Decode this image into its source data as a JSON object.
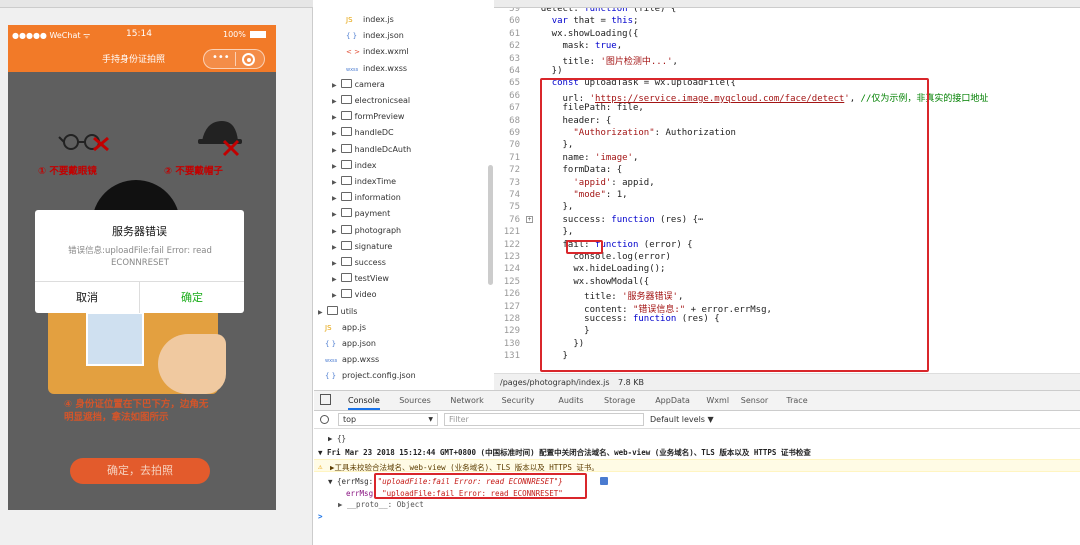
{
  "simulator": {
    "status_left": "●●●●● WeChat ᯤ",
    "status_time": "15:14",
    "status_battery": "100%",
    "nav_title": "手持身份证拍照",
    "capsule_dots": "•••",
    "tip1": "① 不要戴眼镜",
    "tip2": "② 不要戴帽子",
    "tip4": "④ 身份证位置在下巴下方，边角无明显遮挡，拿法如图所示",
    "confirm_btn": "确定，去拍照",
    "modal_title": "服务器错误",
    "modal_content": "错误信息:uploadFile:fail Error: read ECONNRESET",
    "modal_cancel": "取消",
    "modal_ok": "确定"
  },
  "tree": [
    {
      "label": "index.js",
      "icon": "JS",
      "color": "#e5a000",
      "indent": 4
    },
    {
      "label": "index.json",
      "icon": "{ }",
      "color": "#4a7bd0",
      "indent": 4
    },
    {
      "label": "index.wxml",
      "icon": "< >",
      "color": "#e0482e",
      "indent": 4
    },
    {
      "label": "index.wxss",
      "icon": "wxss",
      "color": "#4a7bd0",
      "indent": 4
    },
    {
      "label": "camera",
      "icon": "folder",
      "indent": 2
    },
    {
      "label": "electronicseal",
      "icon": "folder",
      "indent": 2
    },
    {
      "label": "formPreview",
      "icon": "folder",
      "indent": 2
    },
    {
      "label": "handleDC",
      "icon": "folder",
      "indent": 2
    },
    {
      "label": "handleDcAuth",
      "icon": "folder",
      "indent": 2
    },
    {
      "label": "index",
      "icon": "folder",
      "indent": 2
    },
    {
      "label": "indexTime",
      "icon": "folder",
      "indent": 2
    },
    {
      "label": "information",
      "icon": "folder",
      "indent": 2
    },
    {
      "label": "payment",
      "icon": "folder",
      "indent": 2
    },
    {
      "label": "photograph",
      "icon": "folder",
      "indent": 2
    },
    {
      "label": "signature",
      "icon": "folder",
      "indent": 2
    },
    {
      "label": "success",
      "icon": "folder",
      "indent": 2
    },
    {
      "label": "testView",
      "icon": "folder",
      "indent": 2
    },
    {
      "label": "video",
      "icon": "folder",
      "indent": 2
    },
    {
      "label": "utils",
      "icon": "folder",
      "indent": 0
    },
    {
      "label": "app.js",
      "icon": "JS",
      "color": "#e5a000",
      "indent": 1
    },
    {
      "label": "app.json",
      "icon": "{ }",
      "color": "#4a7bd0",
      "indent": 1
    },
    {
      "label": "app.wxss",
      "icon": "wxss",
      "color": "#4a7bd0",
      "indent": 1
    },
    {
      "label": "project.config.json",
      "icon": "{ }",
      "color": "#4a7bd0",
      "indent": 1
    }
  ],
  "editor": {
    "lines": [
      {
        "n": "59",
        "html": "  detect: <span class=\"kw\">function</span> (file) {"
      },
      {
        "n": "60",
        "html": "    <span class=\"kw\">var</span> that = <span class=\"kw\">this</span>;"
      },
      {
        "n": "61",
        "html": "    wx.showLoading({"
      },
      {
        "n": "62",
        "html": "      mask: <span class=\"kw\">true</span>,"
      },
      {
        "n": "63",
        "html": "      title: <span class=\"str\">'图片检测中...'</span>,"
      },
      {
        "n": "64",
        "html": "    })"
      },
      {
        "n": "65",
        "html": "    <span class=\"kw\">const</span> uploadTask = wx.uploadFile({"
      },
      {
        "n": "66",
        "html": "      url: <span class=\"str\">'</span><span class=\"url\">https://service.image.myqcloud.com/face/detect</span><span class=\"str\">'</span>, <span class=\"cm\">//仅为示例，非真实的接口地址</span>"
      },
      {
        "n": "67",
        "html": "      filePath: file,"
      },
      {
        "n": "68",
        "html": "      header: {"
      },
      {
        "n": "69",
        "html": "        <span class=\"str\">\"Authorization\"</span>: Authorization"
      },
      {
        "n": "70",
        "html": "      },"
      },
      {
        "n": "71",
        "html": "      name: <span class=\"str\">'image'</span>,"
      },
      {
        "n": "72",
        "html": "      formData: {"
      },
      {
        "n": "73",
        "html": "        <span class=\"str\">'appid'</span>: appid,"
      },
      {
        "n": "74",
        "html": "        <span class=\"str\">\"mode\"</span>: 1,"
      },
      {
        "n": "75",
        "html": "      },"
      },
      {
        "n": "76",
        "html": "      success: <span class=\"kw\">function</span> (res) {⋯"
      },
      {
        "n": "121",
        "html": "      },"
      },
      {
        "n": "122",
        "html": "      fail: <span class=\"kw\">function</span> (error) {"
      },
      {
        "n": "123",
        "html": "        console.log(error)"
      },
      {
        "n": "124",
        "html": "        wx.hideLoading();"
      },
      {
        "n": "125",
        "html": "        wx.showModal({"
      },
      {
        "n": "126",
        "html": "          title: <span class=\"str\">'服务器错误'</span>,"
      },
      {
        "n": "127",
        "html": "          content: <span class=\"str\">\"错误信息:\"</span> + error.errMsg,"
      },
      {
        "n": "128",
        "html": "          success: <span class=\"kw\">function</span> (res) {"
      },
      {
        "n": "129",
        "html": "          }"
      },
      {
        "n": "130",
        "html": "        })"
      },
      {
        "n": "131",
        "html": "      }"
      }
    ],
    "status_path": "/pages/photograph/index.js",
    "status_size": "7.8 KB"
  },
  "devtools": {
    "tabs": [
      "Console",
      "Sources",
      "Network",
      "Security",
      "Audits",
      "Storage",
      "AppData",
      "Wxml",
      "Sensor",
      "Trace"
    ],
    "context": "top",
    "filter_placeholder": "Filter",
    "levels": "Default levels ▼",
    "log1": "▶ {}",
    "log2": "▼ Fri Mar 23 2018 15:12:44 GMT+0800 (中国标准时间) 配置中关闭合法域名、web-view (业务域名)、TLS 版本以及 HTTPS 证书检查",
    "warn": "▶工具未校验合法域名、web-view (业务域名)、TLS 版本以及 HTTPS 证书。",
    "err_obj_prefix": "▼ {errMsg: ",
    "err_obj_val": "\"uploadFile:fail Error: read ECONNRESET\"}",
    "err_key": "errMsg: ",
    "err_val": "\"uploadFile:fail Error: read ECONNRESET\"",
    "proto": "▶ __proto__: Object",
    "prompt": ">"
  },
  "colors": {
    "accent": "#f27a28",
    "ok_green": "#1aad19",
    "error_red": "#d9262b"
  }
}
